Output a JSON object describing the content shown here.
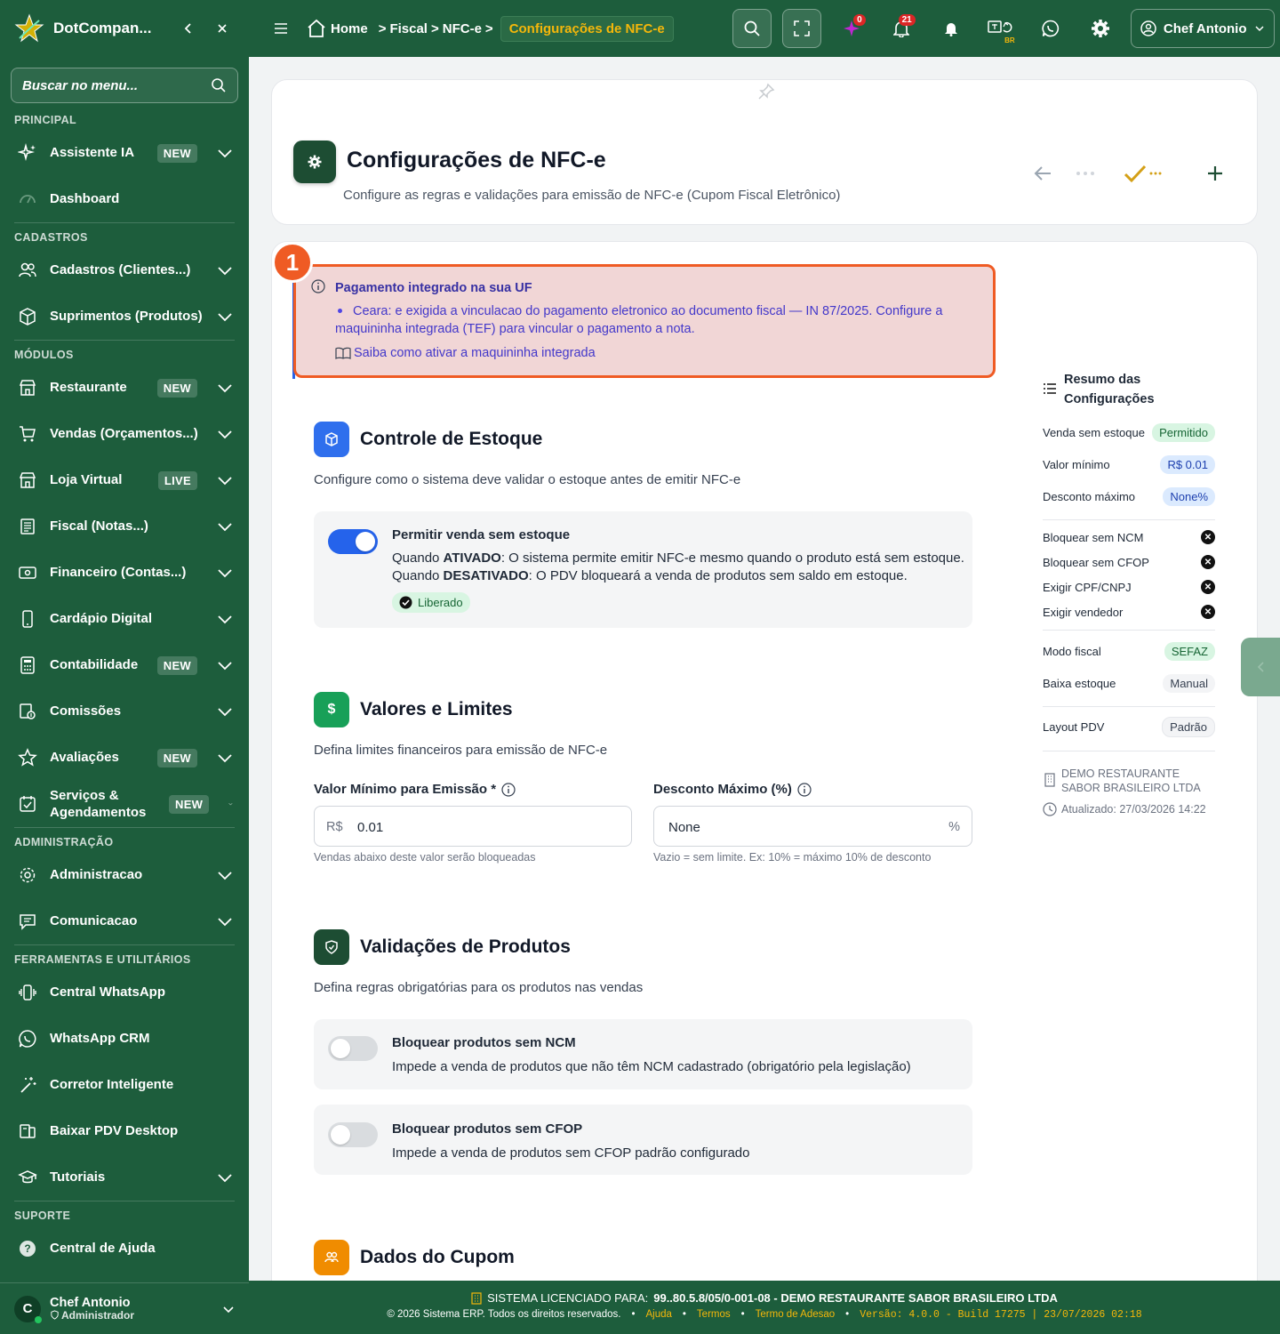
{
  "brand": {
    "name": "DotCompan..."
  },
  "sidebar": {
    "search_placeholder": "Buscar no menu...",
    "sections": {
      "principal": "PRINCIPAL",
      "cadastros": "CADASTROS",
      "modulos": "MÓDULOS",
      "administracao": "ADMINISTRAÇÃO",
      "ferramentas": "FERRAMENTAS E UTILITÁRIOS",
      "suporte": "SUPORTE"
    },
    "items": [
      {
        "label": "Assistente IA",
        "badge": "NEW"
      },
      {
        "label": "Dashboard"
      },
      {
        "label": "Cadastros (Clientes...)"
      },
      {
        "label": "Suprimentos (Produtos)"
      },
      {
        "label": "Restaurante",
        "badge": "NEW"
      },
      {
        "label": "Vendas (Orçamentos...)"
      },
      {
        "label": "Loja Virtual",
        "badge": "LIVE"
      },
      {
        "label": "Fiscal (Notas...)"
      },
      {
        "label": "Financeiro (Contas...)"
      },
      {
        "label": "Cardápio Digital"
      },
      {
        "label": "Contabilidade",
        "badge": "NEW"
      },
      {
        "label": "Comissões"
      },
      {
        "label": "Avaliações",
        "badge": "NEW"
      },
      {
        "label": "Serviços & Agendamentos",
        "badge": "NEW"
      },
      {
        "label": "Administracao"
      },
      {
        "label": "Comunicacao"
      },
      {
        "label": "Central WhatsApp"
      },
      {
        "label": "WhatsApp CRM"
      },
      {
        "label": "Corretor Inteligente"
      },
      {
        "label": "Baixar PDV Desktop"
      },
      {
        "label": "Tutoriais"
      },
      {
        "label": "Central de Ajuda"
      }
    ],
    "user": {
      "initial": "C",
      "name": "Chef Antonio",
      "role": "Administrador"
    }
  },
  "topbar": {
    "breadcrumb": [
      "Home",
      "Fiscal",
      "NFC-e"
    ],
    "breadcrumb_active": "Configurações de NFC-e",
    "ai_count": "0",
    "notif_count": "21",
    "lang_label": "BR",
    "user_name": "Chef Antonio"
  },
  "page": {
    "title": "Configurações de NFC-e",
    "subtitle": "Configure as regras e validações para emissão de NFC-e (Cupom Fiscal Eletrônico)"
  },
  "alert": {
    "number": "1",
    "title": "Pagamento integrado na sua UF",
    "bullet": "Ceara: e exigida a vinculacao do pagamento eletronico ao documento fiscal — IN 87/2025. Configure a maquininha integrada (TEF) para vincular o pagamento a nota.",
    "link": "Saiba como ativar a maquininha integrada"
  },
  "estoque": {
    "title": "Controle de Estoque",
    "desc": "Configure como o sistema deve validar o estoque antes de emitir NFC-e",
    "toggle_title": "Permitir venda sem estoque",
    "when_on_prefix": "Quando ",
    "when_on_bold": "ATIVADO",
    "when_on_text": ": O sistema permite emitir NFC-e mesmo quando o produto está sem estoque.",
    "when_off_prefix": "Quando ",
    "when_off_bold": "DESATIVADO",
    "when_off_text": ": O PDV bloqueará a venda de produtos sem saldo em estoque.",
    "status": "Liberado",
    "enabled": true
  },
  "valores": {
    "title": "Valores e Limites",
    "desc": "Defina limites financeiros para emissão de NFC-e",
    "min_label": "Valor Mínimo para Emissão *",
    "min_prefix": "R$",
    "min_value": "0.01",
    "min_help": "Vendas abaixo deste valor serão bloqueadas",
    "desc_label": "Desconto Máximo (%)",
    "desc_value": "None",
    "desc_suffix": "%",
    "desc_help": "Vazio = sem limite. Ex: 10% = máximo 10% de desconto"
  },
  "validacoes": {
    "title": "Validações de Produtos",
    "desc": "Defina regras obrigatórias para os produtos nas vendas",
    "ncm_title": "Bloquear produtos sem NCM",
    "ncm_desc": "Impede a venda de produtos que não têm NCM cadastrado (obrigatório pela legislação)",
    "ncm_enabled": false,
    "cfop_title": "Bloquear produtos sem CFOP",
    "cfop_desc": "Impede a venda de produtos sem CFOP padrão configurado",
    "cfop_enabled": false
  },
  "cupom": {
    "title": "Dados do Cupom"
  },
  "summary": {
    "title": "Resumo das Configurações",
    "rows": [
      {
        "label": "Venda sem estoque",
        "value": "Permitido"
      },
      {
        "label": "Valor mínimo",
        "value": "R$ 0.01"
      },
      {
        "label": "Desconto máximo",
        "value": "None%"
      },
      {
        "label": "Bloquear sem NCM"
      },
      {
        "label": "Bloquear sem CFOP"
      },
      {
        "label": "Exigir CPF/CNPJ"
      },
      {
        "label": "Exigir vendedor"
      },
      {
        "label": "Modo fiscal",
        "value": "SEFAZ"
      },
      {
        "label": "Baixa estoque",
        "value": "Manual"
      },
      {
        "label": "Layout PDV",
        "value": "Padrão"
      }
    ],
    "company": "DEMO RESTAURANTE SABOR BRASILEIRO LTDA",
    "updated": "Atualizado: 27/03/2026 14:22"
  },
  "footer": {
    "license_prefix": "SISTEMA LICENCIADO PARA:",
    "license_value": "99..80.5.8/05/0-001-08 - DEMO RESTAURANTE SABOR BRASILEIRO LTDA",
    "copyright": "© 2026 Sistema ERP. Todos os direitos reservados.",
    "links": [
      "Ajuda",
      "Termos",
      "Termo de Adesao"
    ],
    "version": "Versão: 4.0.0 - Build 17275 | 23/07/2026 02:18"
  },
  "colors": {
    "brand_green": "#1d5d3c",
    "accent_yellow": "#f5b70a",
    "alert_border": "#ef5b24",
    "toggle_on": "#2563eb"
  }
}
